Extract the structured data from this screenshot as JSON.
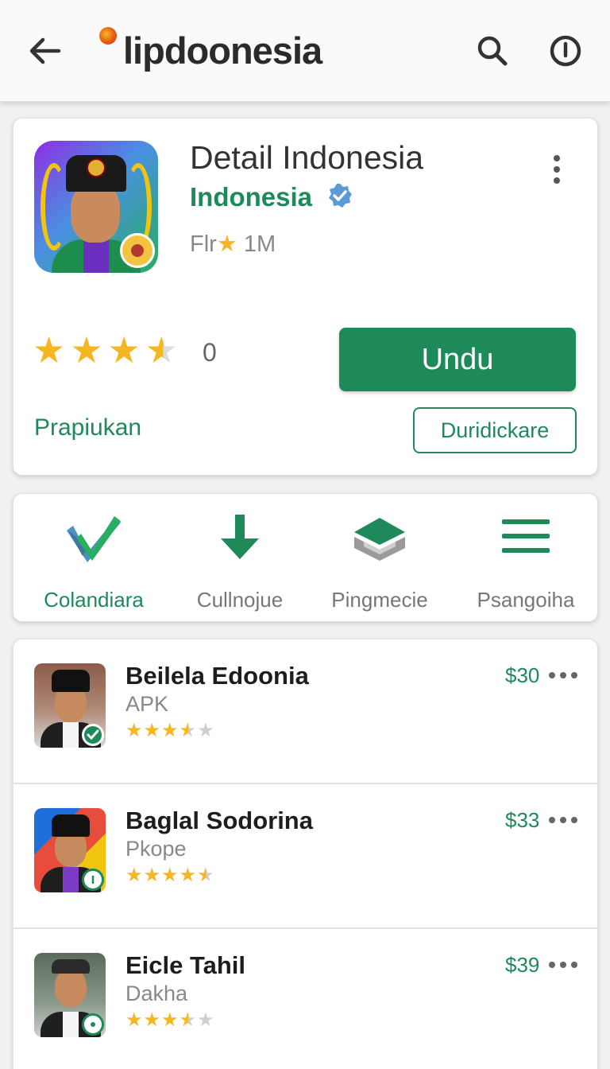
{
  "header": {
    "brand": "lipdoonesia",
    "icons": [
      "back-arrow-icon",
      "search-icon",
      "info-icon"
    ]
  },
  "app": {
    "title": "Detail Indonesia",
    "developer": "Indonesia",
    "meta_prefix": "Flr",
    "meta_suffix": " 1M",
    "rating_value": 3.5,
    "rating_count": "0",
    "install_label": "Undu",
    "link_label": "Prapiukan",
    "secondary_label": "Duridickare"
  },
  "actions": [
    {
      "label": "Colandiara",
      "icon": "checkmark-icon",
      "active": true
    },
    {
      "label": "Cullnojue",
      "icon": "download-arrow-icon",
      "active": false
    },
    {
      "label": "Pingmecie",
      "icon": "box-icon",
      "active": false
    },
    {
      "label": "Psangoiha",
      "icon": "menu-lines-icon",
      "active": false
    }
  ],
  "list": [
    {
      "name": "Beilela Edoonia",
      "sub": "APK",
      "price": "$30",
      "rating": 3.5,
      "badge": "check-badge-icon"
    },
    {
      "name": "Baglal Sodorina",
      "sub": "Pkope",
      "price": "$33",
      "rating": 4.5,
      "badge": "info-badge-icon"
    },
    {
      "name": "Eicle Tahil",
      "sub": "Dakha",
      "price": "$39",
      "rating": 3.5,
      "badge": "dot-badge-icon"
    }
  ],
  "colors": {
    "accent": "#1e8a5a",
    "star": "#f5b721",
    "text": "#222222"
  }
}
